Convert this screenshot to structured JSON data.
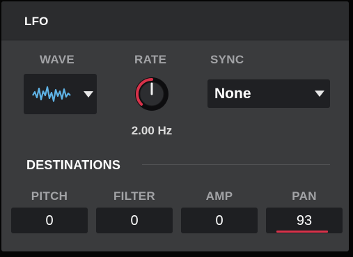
{
  "lfo": {
    "title": "LFO",
    "wave": {
      "label": "WAVE",
      "selected_icon": "random-noise-wave-icon"
    },
    "rate": {
      "label": "RATE",
      "value": "2.00 Hz",
      "knob_level": 0.5
    },
    "sync": {
      "label": "SYNC",
      "value": "None"
    }
  },
  "destinations": {
    "title": "DESTINATIONS",
    "pitch": {
      "label": "PITCH",
      "value": "0"
    },
    "filter": {
      "label": "FILTER",
      "value": "0"
    },
    "amp": {
      "label": "AMP",
      "value": "0"
    },
    "pan": {
      "label": "PAN",
      "value": "93",
      "level": 0.93
    }
  },
  "colors": {
    "accent_red": "#d8324a",
    "wave_blue": "#5fb3e6",
    "panel_bg": "#3a3b3d",
    "header_bg": "#2b2c2e",
    "control_bg": "#1f2023"
  }
}
